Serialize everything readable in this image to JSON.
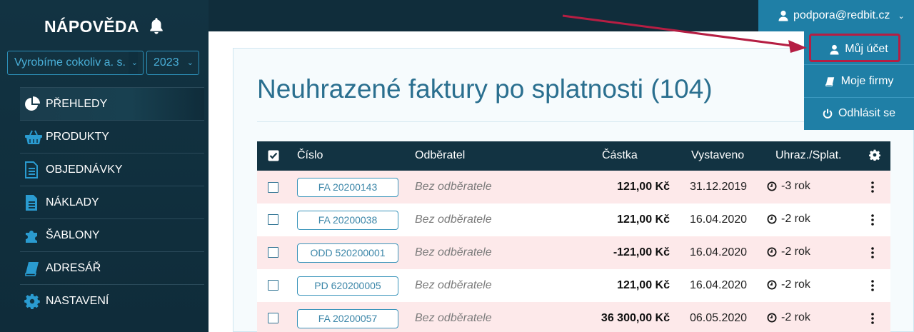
{
  "sidebar": {
    "brand": "NÁPOVĚDA",
    "company_select": "Vyrobíme cokoliv a. s.",
    "year_select": "2023",
    "items": [
      {
        "label": "PŘEHLEDY",
        "icon": "pie-chart-icon"
      },
      {
        "label": "PRODUKTY",
        "icon": "basket-icon"
      },
      {
        "label": "OBJEDNÁVKY",
        "icon": "document-lines-icon"
      },
      {
        "label": "NÁKLADY",
        "icon": "document-filled-icon"
      },
      {
        "label": "ŠABLONY",
        "icon": "puzzle-icon"
      },
      {
        "label": "ADRESÁŘ",
        "icon": "book-icon"
      },
      {
        "label": "NASTAVENÍ",
        "icon": "gear-icon"
      }
    ]
  },
  "account": {
    "email": "podpora@redbit.cz",
    "menu": [
      {
        "label": "Můj účet",
        "icon": "user-icon"
      },
      {
        "label": "Moje firmy",
        "icon": "book-icon"
      },
      {
        "label": "Odhlásit se",
        "icon": "power-icon"
      }
    ]
  },
  "page": {
    "title": "Neuhrazené faktury po splatnosti (104)"
  },
  "table": {
    "headers": {
      "number": "Číslo",
      "customer": "Odběratel",
      "amount": "Částka",
      "issued": "Vystaveno",
      "paid_due": "Uhraz./Splat."
    },
    "rows": [
      {
        "number": "FA 20200143",
        "customer": "Bez odběratele",
        "amount": "121,00 Kč",
        "issued": "31.12.2019",
        "due": "-3 rok"
      },
      {
        "number": "FA 20200038",
        "customer": "Bez odběratele",
        "amount": "121,00 Kč",
        "issued": "16.04.2020",
        "due": "-2 rok"
      },
      {
        "number": "ODD 520200001",
        "customer": "Bez odběratele",
        "amount": "-121,00 Kč",
        "issued": "16.04.2020",
        "due": "-2 rok"
      },
      {
        "number": "PD 620200005",
        "customer": "Bez odběratele",
        "amount": "121,00 Kč",
        "issued": "16.04.2020",
        "due": "-2 rok"
      },
      {
        "number": "FA 20200057",
        "customer": "Bez odběratele",
        "amount": "36 300,00 Kč",
        "issued": "06.05.2020",
        "due": "-2 rok"
      }
    ]
  },
  "colors": {
    "sidebar": "#123342",
    "accent": "#1f7fa6",
    "highlight": "#b51e43",
    "row_pink": "#fde9ea"
  }
}
